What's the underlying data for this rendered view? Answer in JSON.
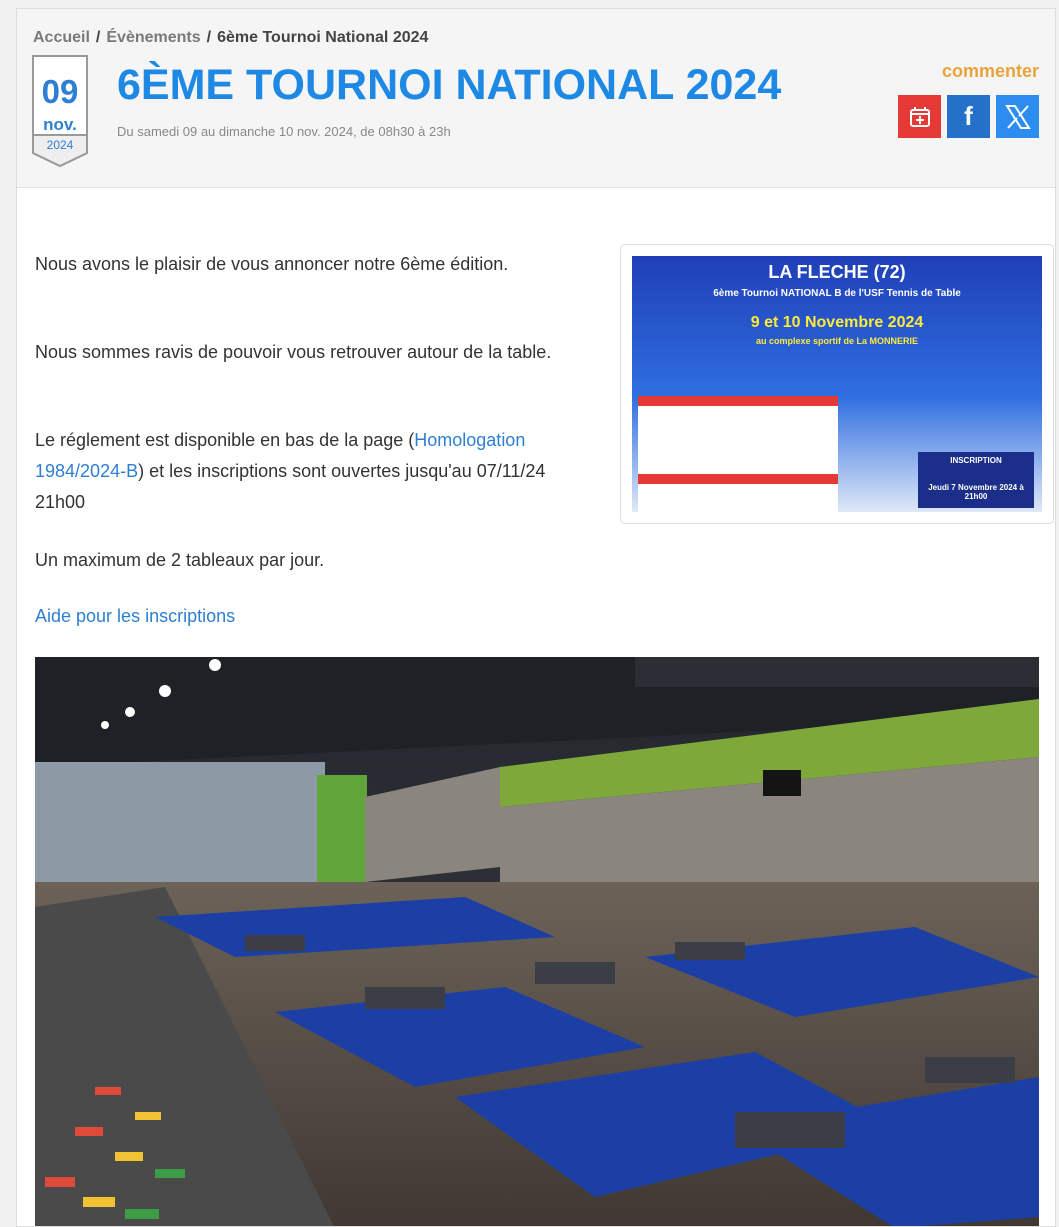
{
  "breadcrumb": {
    "home": "Accueil",
    "events": "Évènements",
    "current": "6ème Tournoi National 2024"
  },
  "event": {
    "day": "09",
    "month": "nov.",
    "year": "2024",
    "title": "6ÈME TOURNOI NATIONAL 2024",
    "subtitle": "Du samedi 09 au dimanche 10 nov. 2024, de 08h30 à 23h"
  },
  "actions": {
    "comment": "commenter"
  },
  "body": {
    "p1": "Nous avons le plaisir de vous annoncer notre 6ème édition.",
    "p2": "Nous sommes ravis de pouvoir vous retrouver autour de la table.",
    "p3_before": "Le réglement est disponible en bas de la page (",
    "p3_link": "Homologation 1984/2024-B",
    "p3_after": ") et les inscriptions sont ouvertes jusqu'au 07/11/24 21h00",
    "p4": "Un maximum de 2 tableaux par jour.",
    "help_link": "Aide pour les inscriptions"
  },
  "poster": {
    "heading": "LA FLECHE (72)",
    "sub": "6ème Tournoi NATIONAL B de l'USF Tennis de Table",
    "dates": "9 et 10 Novembre 2024",
    "venue": "au complexe sportif de La MONNERIE",
    "inscription": "INSCRIPTION",
    "deadline": "Jeudi 7 Novembre 2024 à 21h00"
  },
  "colors": {
    "accent": "#1e88e5",
    "comment": "#e8a33d",
    "calendar": "#e53935",
    "facebook": "#2570c8",
    "x": "#2d8cf0"
  }
}
